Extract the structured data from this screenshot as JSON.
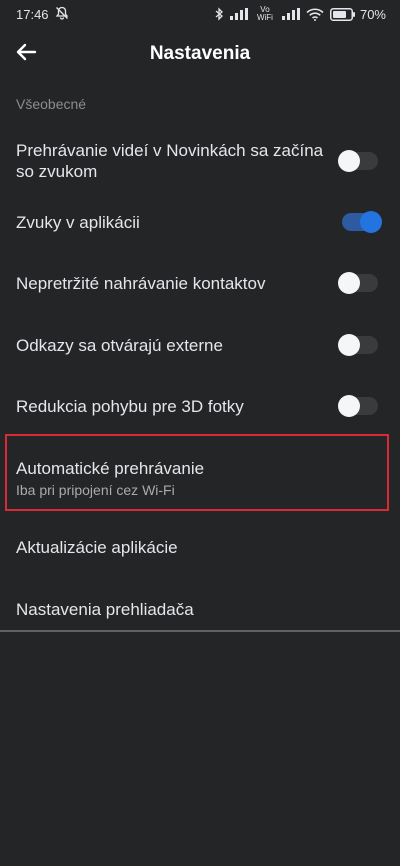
{
  "status_bar": {
    "time": "17:46",
    "network_label": "Vo WiFi",
    "battery": "70%",
    "icons": [
      "mute-icon",
      "bluetooth-icon",
      "signal-icon",
      "wifi-icon",
      "battery-icon"
    ]
  },
  "header": {
    "title": "Nastavenia",
    "back_icon": "arrow-left-icon"
  },
  "section": {
    "label": "Všeobecné"
  },
  "settings": {
    "items": [
      {
        "label": "Prehrávanie videí v Novinkách sa začína so zvukom",
        "toggle": false
      },
      {
        "label": "Zvuky v aplikácii",
        "toggle": true
      },
      {
        "label": "Nepretržité nahrávanie kontaktov",
        "toggle": false
      },
      {
        "label": "Odkazy sa otvárajú externe",
        "toggle": false
      },
      {
        "label": "Redukcia pohybu pre 3D fotky",
        "toggle": false
      },
      {
        "label": "Automatické prehrávanie",
        "sublabel": "Iba pri pripojení cez Wi-Fi",
        "highlighted": true
      },
      {
        "label": "Aktualizácie aplikácie"
      },
      {
        "label": "Nastavenia prehliadača"
      }
    ]
  },
  "colors": {
    "background": "#242526",
    "toggle_on": "#2374e1",
    "highlight_border": "#d62b35"
  }
}
